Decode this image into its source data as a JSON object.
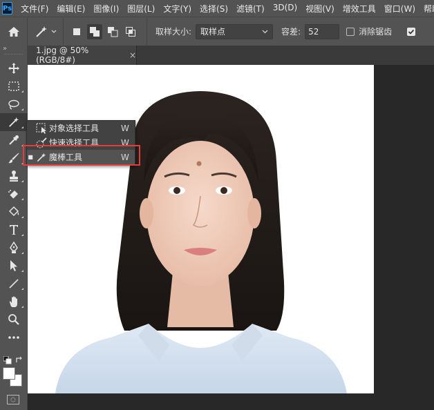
{
  "app": {
    "logo_text": "Ps"
  },
  "menu": [
    "文件(F)",
    "编辑(E)",
    "图像(I)",
    "图层(L)",
    "文字(Y)",
    "选择(S)",
    "滤镜(T)",
    "3D(D)",
    "视图(V)",
    "增效工具",
    "窗口(W)",
    "帮助(H)"
  ],
  "options": {
    "sample_size_label": "取样大小:",
    "sample_size_value": "取样点",
    "tolerance_label": "容差:",
    "tolerance_value": "52",
    "antialias_label": "消除锯齿",
    "antialias_checked": false,
    "contiguous_checked": true
  },
  "toolbar": {
    "collapse_glyph": "»",
    "tools": [
      "move",
      "marquee",
      "lasso",
      "magic-wand",
      "eyedropper",
      "brush",
      "stamp",
      "eraser",
      "paint-bucket",
      "type",
      "pen",
      "path-selection",
      "line",
      "hand",
      "zoom",
      "more"
    ]
  },
  "document": {
    "tab_title": "1.jpg @ 50%(RGB/8#)",
    "close_glyph": "×"
  },
  "flyout": {
    "items": [
      {
        "label": "对象选择工具",
        "shortcut": "W",
        "selected": false
      },
      {
        "label": "快速选择工具",
        "shortcut": "W",
        "selected": false
      },
      {
        "label": "魔棒工具",
        "shortcut": "W",
        "selected": true
      }
    ]
  },
  "colors": {
    "highlight": "#e43b3b",
    "panel": "#535353",
    "canvas": "#ffffff"
  }
}
